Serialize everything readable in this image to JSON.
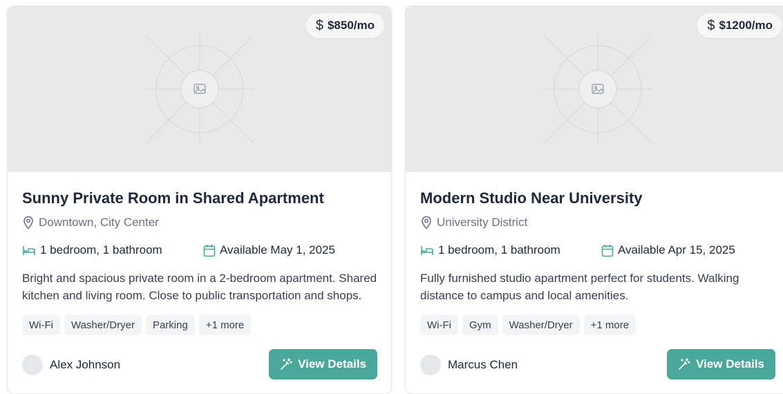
{
  "colors": {
    "accent": "#4aa79a",
    "image_bg": "#e9e9e9",
    "muted_text": "#6b7280",
    "tag_bg": "#f3f4f6"
  },
  "listings": [
    {
      "price": "$850/mo",
      "title": "Sunny Private Room in Shared Apartment",
      "location": "Downtown, City Center",
      "rooms": "1 bedroom, 1 bathroom",
      "available": "Available May 1, 2025",
      "description": "Bright and spacious private room in a 2-bedroom apartment. Shared kitchen and living room. Close to public transportation and shops.",
      "tags": [
        "Wi-Fi",
        "Washer/Dryer",
        "Parking",
        "+1 more"
      ],
      "owner": "Alex Johnson",
      "button_label": "View Details"
    },
    {
      "price": "$1200/mo",
      "title": "Modern Studio Near University",
      "location": "University District",
      "rooms": "1 bedroom, 1 bathroom",
      "available": "Available Apr 15, 2025",
      "description": "Fully furnished studio apartment perfect for students. Walking distance to campus and local amenities.",
      "tags": [
        "Wi-Fi",
        "Gym",
        "Washer/Dryer",
        "+1 more"
      ],
      "owner": "Marcus Chen",
      "button_label": "View Details"
    }
  ],
  "icons": {
    "price": "dollar-icon",
    "location": "map-pin-icon",
    "rooms": "bed-icon",
    "date": "calendar-icon",
    "image": "image-placeholder-icon",
    "button": "magic-wand-icon"
  }
}
